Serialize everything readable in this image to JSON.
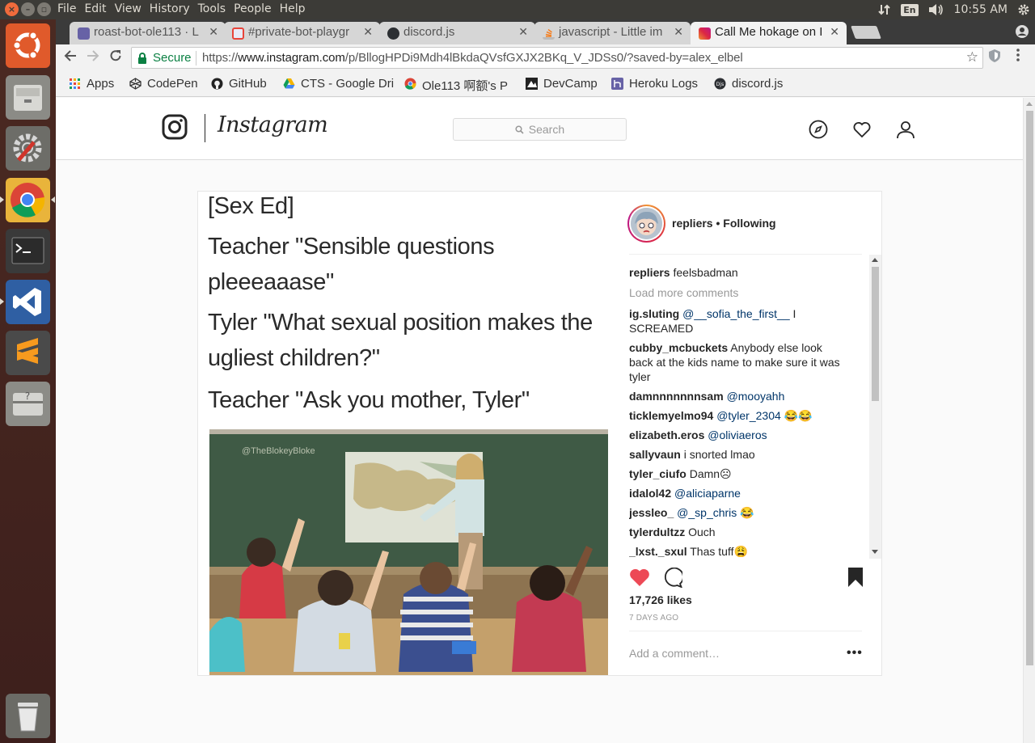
{
  "system": {
    "menu": [
      "File",
      "Edit",
      "View",
      "History",
      "Tools",
      "People",
      "Help"
    ],
    "keyboard": "En",
    "time": "10:55 AM"
  },
  "tabs": [
    {
      "title": "roast-bot-ole113 · L",
      "icon": "heroku-icon",
      "color": "#6762a6"
    },
    {
      "title": "#private-bot-playgr",
      "icon": "discord-tab-icon",
      "color": "#e8ebf8"
    },
    {
      "title": "discord.js",
      "icon": "discordjs-icon",
      "color": "#2c2f33"
    },
    {
      "title": "javascript - Little im",
      "icon": "stackoverflow-icon",
      "color": "#f48024"
    },
    {
      "title": "Call Me hokage on I",
      "icon": "instagram-icon",
      "color": "#c13584"
    }
  ],
  "address": {
    "secure_label": "Secure",
    "scheme": "https://",
    "host": "www.instagram.com",
    "path": "/p/BllogHPDi9Mdh4lBkdaQVsfGXJX2BKq_V_JDSs0/?saved-by=alex_elbel"
  },
  "bookmarks": [
    {
      "label": "Apps",
      "icon": "apps-grid-icon"
    },
    {
      "label": "CodePen",
      "icon": "codepen-icon"
    },
    {
      "label": "GitHub",
      "icon": "github-icon"
    },
    {
      "label": "CTS - Google Dri",
      "icon": "google-drive-icon"
    },
    {
      "label": "Ole113 啊额's P",
      "icon": "chrome-icon"
    },
    {
      "label": "DevCamp",
      "icon": "devcamp-icon"
    },
    {
      "label": "Heroku Logs",
      "icon": "heroku-icon"
    },
    {
      "label": "discord.js",
      "icon": "discordjs-icon"
    }
  ],
  "instagram": {
    "wordmark": "Instagram",
    "search_placeholder": "Search"
  },
  "post": {
    "meme_lines": [
      "[Sex Ed]",
      "Teacher \"Sensible questions",
      "pleeeaaase\"",
      "Tyler \"What sexual position makes the",
      "ugliest children?\"",
      "Teacher \"Ask you mother, Tyler\""
    ],
    "watermark": "@TheBlokeyBloke",
    "owner": "repliers",
    "owner_separator": " • ",
    "follow_state": "Following",
    "caption": {
      "user": "repliers",
      "text": "feelsbadman"
    },
    "load_more": "Load more comments",
    "comments": [
      {
        "user": "ig.sluting",
        "mention": "@__sofia_the_first__",
        "text": " I SCREAMED"
      },
      {
        "user": "cubby_mcbuckets",
        "mention": "",
        "text": "Anybody else look back at the kids name to make sure it was tyler"
      },
      {
        "user": "damnnnnnnnsam",
        "mention": "@mooyahh",
        "text": ""
      },
      {
        "user": "ticklemyelmo94",
        "mention": "@tyler_2304",
        "text": " 😂😂"
      },
      {
        "user": "elizabeth.eros",
        "mention": "@oliviaeros",
        "text": ""
      },
      {
        "user": "sallyvaun",
        "mention": "",
        "text": "i snorted lmao"
      },
      {
        "user": "tyler_ciufo",
        "mention": "",
        "text": "Damn☹"
      },
      {
        "user": "idalol42",
        "mention": "@aliciaparne",
        "text": ""
      },
      {
        "user": "jessleo_",
        "mention": "@_sp_chris",
        "text": " 😂"
      },
      {
        "user": "tylerdultzz",
        "mention": "",
        "text": "Ouch"
      },
      {
        "user": "_lxst._sxul",
        "mention": "",
        "text": "Thas tuff😩"
      }
    ],
    "likes": "17,726 likes",
    "posted": "7 DAYS AGO",
    "add_comment_placeholder": "Add a comment…",
    "more_label": "•••"
  }
}
